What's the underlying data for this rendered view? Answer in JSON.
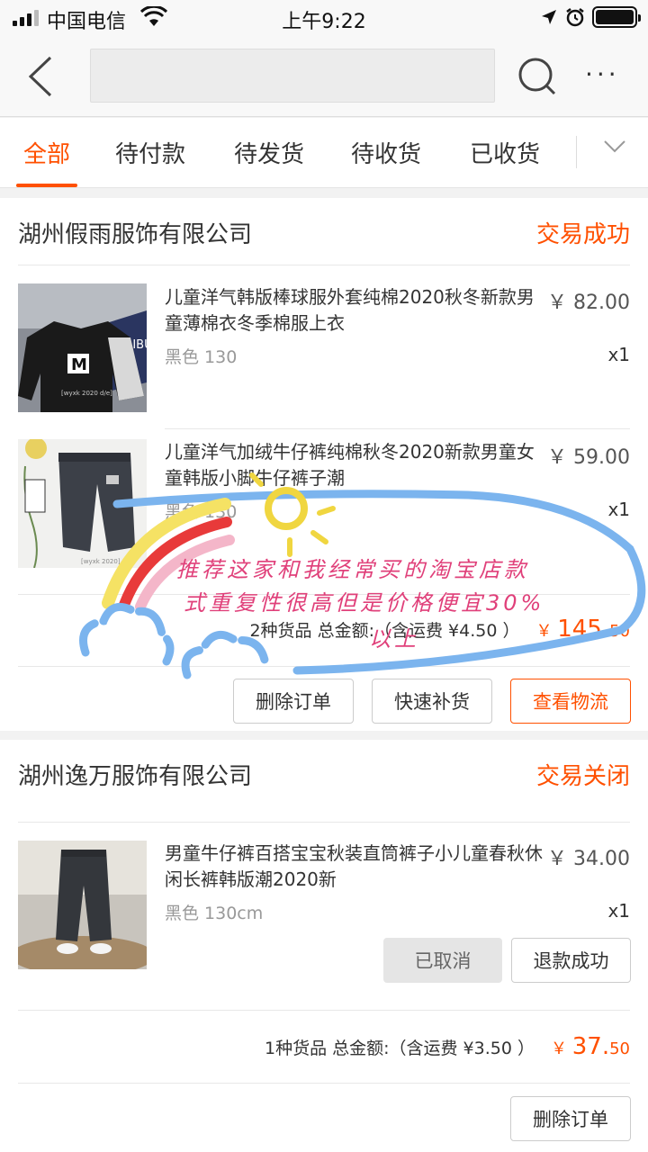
{
  "status_bar": {
    "carrier": "中国电信",
    "time": "上午9:22"
  },
  "nav": {
    "search_placeholder": "",
    "more_label": "···"
  },
  "tabs": [
    {
      "label": "全部",
      "active": true
    },
    {
      "label": "待付款"
    },
    {
      "label": "待发货"
    },
    {
      "label": "待收货"
    },
    {
      "label": "已收货"
    }
  ],
  "orders": [
    {
      "shop": "湖州假雨服饰有限公司",
      "status": "交易成功",
      "items": [
        {
          "name": "儿童洋气韩版棒球服外套纯棉2020秋冬新款男童薄棉衣冬季棉服上衣",
          "price": "￥ 82.00",
          "spec": "黑色 130",
          "qty": "x1"
        },
        {
          "name": "儿童洋气加绒牛仔裤纯棉秋冬2020新款男童女童韩版小脚牛仔裤子潮",
          "price": "￥ 59.00",
          "spec": "黑色 130",
          "qty": "x1"
        }
      ],
      "summary": "2种货品 总金额:（含运费 ¥4.50 ）",
      "total_symbol": "￥",
      "total_int": "145.",
      "total_dec": "50",
      "buttons": [
        "删除订单",
        "快速补货",
        "查看物流"
      ]
    },
    {
      "shop": "湖州逸万服饰有限公司",
      "status": "交易关闭",
      "items": [
        {
          "name": "男童牛仔裤百搭宝宝秋装直筒裤子小儿童春秋休闲长裤韩版潮2020新",
          "price": "￥ 34.00",
          "spec": "黑色 130cm",
          "qty": "x1",
          "buttons": [
            "已取消",
            "退款成功"
          ]
        }
      ],
      "summary": "1种货品 总金额:（含运费 ¥3.50 ）",
      "total_symbol": "￥",
      "total_int": "37.",
      "total_dec": "50",
      "buttons": [
        "删除订单"
      ]
    }
  ],
  "sticker": {
    "line1": "推荐这家和我经常买的淘宝店款",
    "line2": "式重复性很高但是价格便宜30%",
    "line3": "以上"
  },
  "colors": {
    "accent": "#ff5000"
  }
}
